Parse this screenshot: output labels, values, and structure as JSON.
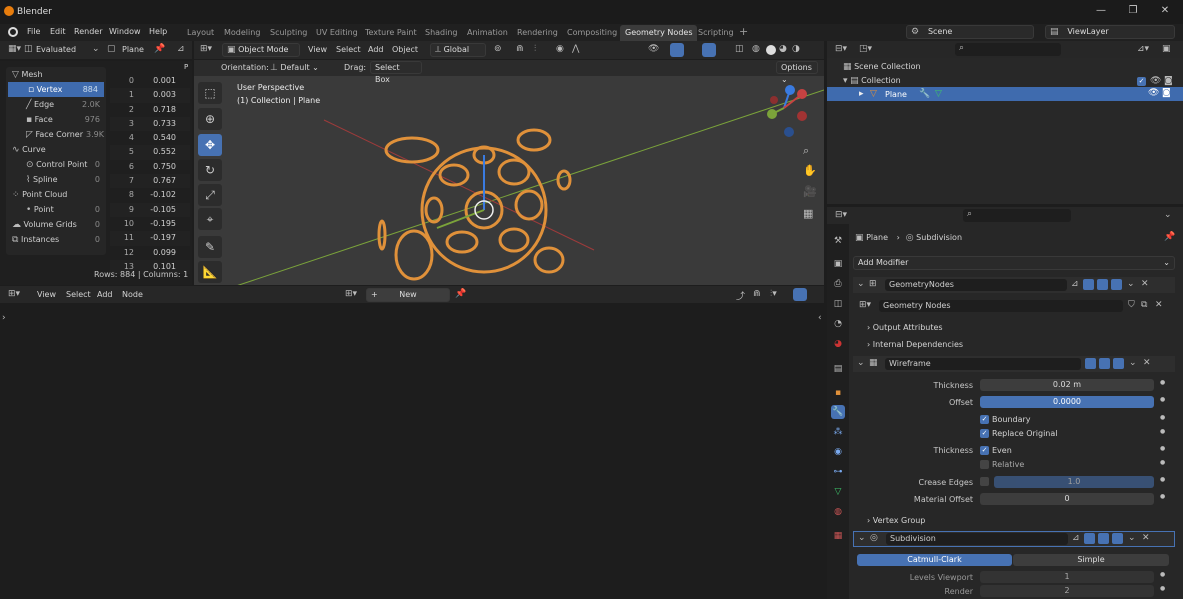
{
  "app": {
    "title": "Blender"
  },
  "menu": [
    "File",
    "Edit",
    "Render",
    "Window",
    "Help"
  ],
  "workspaces": [
    "Layout",
    "Modeling",
    "Sculpting",
    "UV Editing",
    "Texture Paint",
    "Shading",
    "Animation",
    "Rendering",
    "Compositing",
    "Geometry Nodes",
    "Scripting"
  ],
  "active_workspace": "Geometry Nodes",
  "scene": {
    "label": "Scene",
    "viewlayer": "ViewLayer"
  },
  "spreadsheet": {
    "mode": "Evaluated",
    "object": "Plane",
    "p": "P",
    "domains": [
      {
        "group": "Mesh",
        "items": [
          {
            "label": "Vertex",
            "count": "884",
            "sel": true
          },
          {
            "label": "Edge",
            "count": "2.0K"
          },
          {
            "label": "Face",
            "count": "976"
          },
          {
            "label": "Face Corner",
            "count": "3.9K"
          }
        ]
      },
      {
        "group": "Curve",
        "items": [
          {
            "label": "Control Point",
            "count": "0"
          },
          {
            "label": "Spline",
            "count": "0"
          }
        ]
      },
      {
        "group": "Point Cloud",
        "items": [
          {
            "label": "Point",
            "count": "0"
          }
        ]
      },
      {
        "group": "Volume Grids",
        "count": "0",
        "items": []
      },
      {
        "group": "Instances",
        "count": "0",
        "items": []
      }
    ],
    "rows": [
      [
        "0",
        "0.001"
      ],
      [
        "1",
        "0.003"
      ],
      [
        "2",
        "0.718"
      ],
      [
        "3",
        "0.733"
      ],
      [
        "4",
        "0.540"
      ],
      [
        "5",
        "0.552"
      ],
      [
        "6",
        "0.750"
      ],
      [
        "7",
        "0.767"
      ],
      [
        "8",
        "-0.102"
      ],
      [
        "9",
        "-0.105"
      ],
      [
        "10",
        "-0.195"
      ],
      [
        "11",
        "-0.197"
      ],
      [
        "12",
        "0.099"
      ],
      [
        "13",
        "0.101"
      ]
    ],
    "footer": "Rows: 884  |  Columns: 1"
  },
  "viewport": {
    "mode": "Object Mode",
    "menus": [
      "View",
      "Select",
      "Add",
      "Object"
    ],
    "transform": "Global",
    "orientation_label": "Orientation:",
    "orientation": "Default",
    "drag_label": "Drag:",
    "drag": "Select Box",
    "options": "Options",
    "overlay_title": "User Perspective",
    "overlay_sub": "(1) Collection | Plane"
  },
  "node_editor": {
    "menus": [
      "View",
      "Select",
      "Add",
      "Node"
    ],
    "new": "New"
  },
  "outliner": {
    "items": [
      "Scene Collection",
      "Collection",
      "Plane"
    ]
  },
  "properties": {
    "breadcrumb_obj": "Plane",
    "breadcrumb_mod": "Subdivision",
    "add_modifier": "Add Modifier",
    "gn": {
      "name": "GeometryNodes",
      "tree": "Geometry Nodes",
      "output": "Output Attributes",
      "internal": "Internal Dependencies"
    },
    "wire": {
      "name": "Wireframe",
      "thickness_l": "Thickness",
      "thickness": "0.02 m",
      "offset_l": "Offset",
      "offset": "0.0000",
      "boundary": "Boundary",
      "replace": "Replace Original",
      "thick2_l": "Thickness",
      "even": "Even",
      "relative": "Relative",
      "crease_l": "Crease Edges",
      "crease": "1.0",
      "mat_l": "Material Offset",
      "mat": "0",
      "vgroup": "Vertex Group"
    },
    "subd": {
      "name": "Subdivision",
      "cc": "Catmull-Clark",
      "simple": "Simple",
      "lv_l": "Levels Viewport",
      "lv": "1",
      "render_l": "Render",
      "render": "2"
    }
  },
  "colors": {
    "accent": "#4772b3",
    "selected": "#3f6bae",
    "mesh": "#e0913a"
  }
}
